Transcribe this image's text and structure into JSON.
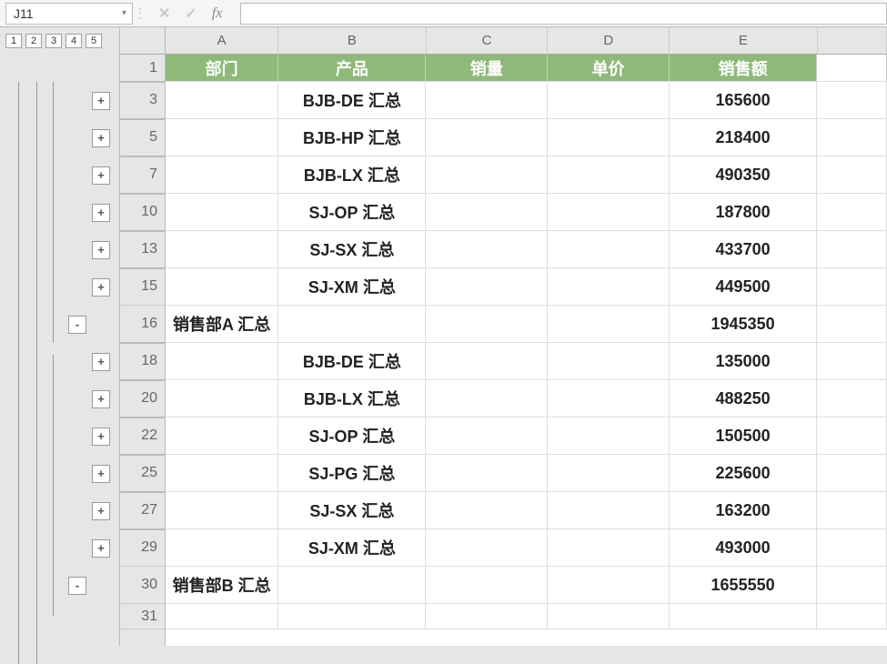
{
  "formula_bar": {
    "name_box": "J11",
    "cancel_label": "✕",
    "confirm_label": "✓",
    "fx_label": "fx",
    "formula_value": ""
  },
  "outline": {
    "levels": [
      "1",
      "2",
      "3",
      "4",
      "5"
    ],
    "buttons": [
      {
        "type": "+",
        "indent": 2
      },
      {
        "type": "+",
        "indent": 2
      },
      {
        "type": "+",
        "indent": 2
      },
      {
        "type": "+",
        "indent": 2
      },
      {
        "type": "+",
        "indent": 2
      },
      {
        "type": "+",
        "indent": 2
      },
      {
        "type": "-",
        "indent": 1
      },
      {
        "type": "+",
        "indent": 2
      },
      {
        "type": "+",
        "indent": 2
      },
      {
        "type": "+",
        "indent": 2
      },
      {
        "type": "+",
        "indent": 2
      },
      {
        "type": "+",
        "indent": 2
      },
      {
        "type": "+",
        "indent": 2
      },
      {
        "type": "-",
        "indent": 1
      }
    ]
  },
  "columns": [
    "A",
    "B",
    "C",
    "D",
    "E"
  ],
  "header_row": {
    "A": "部门",
    "B": "产品",
    "C": "销量",
    "D": "单价",
    "E": "销售额"
  },
  "row_numbers": [
    "1",
    "3",
    "5",
    "7",
    "10",
    "13",
    "15",
    "16",
    "18",
    "20",
    "22",
    "25",
    "27",
    "29",
    "30",
    "31"
  ],
  "rows": [
    {
      "num": "3",
      "A": "",
      "B": "BJB-DE 汇总",
      "E": "165600",
      "bold": true
    },
    {
      "num": "5",
      "A": "",
      "B": "BJB-HP 汇总",
      "E": "218400",
      "bold": true
    },
    {
      "num": "7",
      "A": "",
      "B": "BJB-LX 汇总",
      "E": "490350",
      "bold": true
    },
    {
      "num": "10",
      "A": "",
      "B": "SJ-OP 汇总",
      "E": "187800",
      "bold": true
    },
    {
      "num": "13",
      "A": "",
      "B": "SJ-SX 汇总",
      "E": "433700",
      "bold": true
    },
    {
      "num": "15",
      "A": "",
      "B": "SJ-XM 汇总",
      "E": "449500",
      "bold": true
    },
    {
      "num": "16",
      "A": "销售部A 汇总",
      "B": "",
      "E": "1945350",
      "bold": true
    },
    {
      "num": "18",
      "A": "",
      "B": "BJB-DE 汇总",
      "E": "135000",
      "bold": true
    },
    {
      "num": "20",
      "A": "",
      "B": "BJB-LX 汇总",
      "E": "488250",
      "bold": true
    },
    {
      "num": "22",
      "A": "",
      "B": "SJ-OP 汇总",
      "E": "150500",
      "bold": true
    },
    {
      "num": "25",
      "A": "",
      "B": "SJ-PG 汇总",
      "E": "225600",
      "bold": true
    },
    {
      "num": "27",
      "A": "",
      "B": "SJ-SX 汇总",
      "E": "163200",
      "bold": true
    },
    {
      "num": "29",
      "A": "",
      "B": "SJ-XM 汇总",
      "E": "493000",
      "bold": true
    },
    {
      "num": "30",
      "A": "销售部B 汇总",
      "B": "",
      "E": "1655550",
      "bold": true
    }
  ]
}
